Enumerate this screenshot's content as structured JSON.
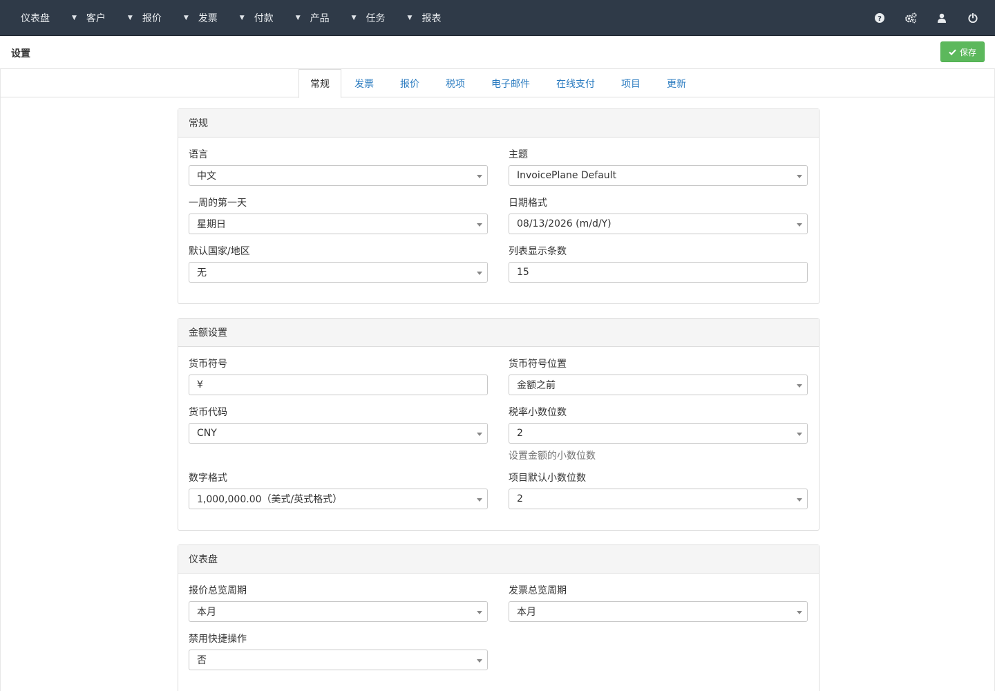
{
  "nav": {
    "items": [
      {
        "label": "仪表盘"
      },
      {
        "label": "客户"
      },
      {
        "label": "报价"
      },
      {
        "label": "发票"
      },
      {
        "label": "付款"
      },
      {
        "label": "产品"
      },
      {
        "label": "任务"
      },
      {
        "label": "报表"
      }
    ],
    "icons": [
      "help-icon",
      "settings-icon",
      "user-icon",
      "power-icon"
    ]
  },
  "header": {
    "title": "设置",
    "save_label": "保存"
  },
  "tabs": [
    {
      "label": "常规",
      "active": true
    },
    {
      "label": "发票"
    },
    {
      "label": "报价"
    },
    {
      "label": "税项"
    },
    {
      "label": "电子邮件"
    },
    {
      "label": "在线支付"
    },
    {
      "label": "项目"
    },
    {
      "label": "更新"
    }
  ],
  "general": {
    "heading": "常规",
    "language": {
      "label": "语言",
      "value": "中文"
    },
    "theme": {
      "label": "主题",
      "value": "InvoicePlane Default"
    },
    "first_day": {
      "label": "一周的第一天",
      "value": "星期日"
    },
    "date_format": {
      "label": "日期格式",
      "value": "08/13/2026 (m/d/Y)"
    },
    "default_country": {
      "label": "默认国家/地区",
      "value": "无"
    },
    "rows_per_page": {
      "label": "列表显示条数",
      "value": "15"
    }
  },
  "amount": {
    "heading": "金额设置",
    "currency_symbol": {
      "label": "货币符号",
      "value": "¥"
    },
    "symbol_placement": {
      "label": "货币符号位置",
      "value": "金额之前"
    },
    "currency_code": {
      "label": "货币代码",
      "value": "CNY"
    },
    "tax_decimals": {
      "label": "税率小数位数",
      "value": "2",
      "help": "设置金额的小数位数"
    },
    "number_format": {
      "label": "数字格式",
      "value": "1,000,000.00（美式/英式格式）"
    },
    "item_decimals": {
      "label": "项目默认小数位数",
      "value": "2"
    }
  },
  "dashboard": {
    "heading": "仪表盘",
    "quote_period": {
      "label": "报价总览周期",
      "value": "本月"
    },
    "invoice_period": {
      "label": "发票总览周期",
      "value": "本月"
    },
    "disable_quick": {
      "label": "禁用快捷操作",
      "value": "否"
    }
  }
}
